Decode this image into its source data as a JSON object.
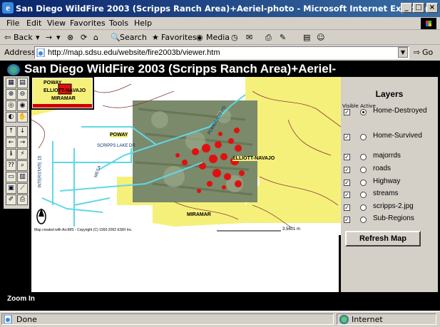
{
  "window": {
    "title": "San Diego WildFire 2003 (Scripps Ranch Area)+Aeriel-photo - Microsoft Internet Explorer",
    "min_glyph": "_",
    "max_glyph": "□",
    "close_glyph": "×"
  },
  "menu": [
    "File",
    "Edit",
    "View",
    "Favorites",
    "Tools",
    "Help"
  ],
  "toolbar": {
    "back": "Back",
    "search": "Search",
    "favorites": "Favorites",
    "media": "Media"
  },
  "address": {
    "label": "Address",
    "url": "http://map.sdsu.edu/website/fire2003b/viewer.htm",
    "go": "Go"
  },
  "page": {
    "title": "San Diego WildFire 2003 (Scripps Ranch Area)+Aeriel-",
    "status_text": "Zoom In"
  },
  "map": {
    "labels": {
      "poway": "POWAY",
      "elliott": "ELLIOTT-NAVAJO",
      "miramar": "MIRAMAR",
      "scripps_lake": "SCRIPPS LAKE DR",
      "interstate": "INTERSTATE 15",
      "pomerado": "POMERADO RD",
      "mesa": "MESA"
    },
    "overview": {
      "poway": "POWAY",
      "elliott": "ELLIOTT-NAVAJO",
      "miramar": "MIRAMAR"
    },
    "copyright": "Map created with ArcIMS - Copyright (C) 1992-2002 ESRI Inc.",
    "scale": "3.5601 m"
  },
  "layers": {
    "title": "Layers",
    "header": "Visible Active",
    "items": [
      {
        "label": "Home-Destroyed",
        "visible": true,
        "active": true
      },
      {
        "label": "Home-Survived",
        "visible": true,
        "active": false
      },
      {
        "label": "majorrds",
        "visible": true,
        "active": false
      },
      {
        "label": "roads",
        "visible": true,
        "active": false
      },
      {
        "label": "Highway",
        "visible": true,
        "active": false
      },
      {
        "label": "streams",
        "visible": true,
        "active": false
      },
      {
        "label": "scripps-2.jpg",
        "visible": true,
        "active": false
      },
      {
        "label": "Sub-Regions",
        "visible": true,
        "active": false
      }
    ],
    "refresh": "Refresh Map"
  },
  "statusbar": {
    "done": "Done",
    "zone": "Internet"
  },
  "colors": {
    "titlebar": "#0a246a",
    "map_yellow": "#f5f07a",
    "roads_cyan": "#5fd8e8",
    "fire_red": "#e01010"
  }
}
